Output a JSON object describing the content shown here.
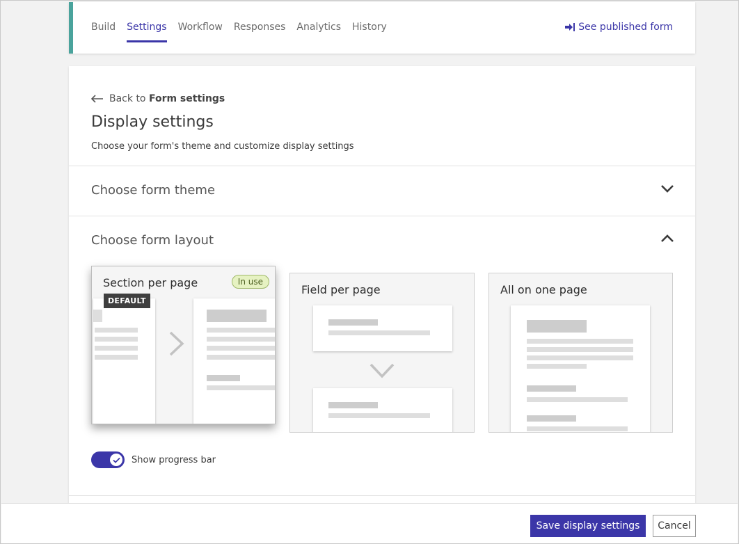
{
  "nav": {
    "tabs": [
      {
        "label": "Build"
      },
      {
        "label": "Settings"
      },
      {
        "label": "Workflow"
      },
      {
        "label": "Responses"
      },
      {
        "label": "Analytics"
      },
      {
        "label": "History"
      }
    ],
    "active_tab": "Settings",
    "published_link": "See published form"
  },
  "page": {
    "back_prefix": "Back to",
    "back_target": "Form settings",
    "title": "Display settings",
    "subtitle": "Choose your form's theme and customize display settings"
  },
  "sections": {
    "theme": "Choose form theme",
    "layout": "Choose form layout"
  },
  "layouts": [
    {
      "label": "Section per page",
      "badge": "In use",
      "tag": "DEFAULT",
      "selected": true
    },
    {
      "label": "Field per page"
    },
    {
      "label": "All on one page"
    }
  ],
  "progress_toggle": {
    "label": "Show progress bar",
    "on": true
  },
  "footer": {
    "save_label": "Save display settings",
    "cancel_label": "Cancel"
  },
  "colors": {
    "accent": "#3b36a8",
    "nav_stripe": "#4aa39c",
    "in_use_bg": "#e6f2c2"
  }
}
